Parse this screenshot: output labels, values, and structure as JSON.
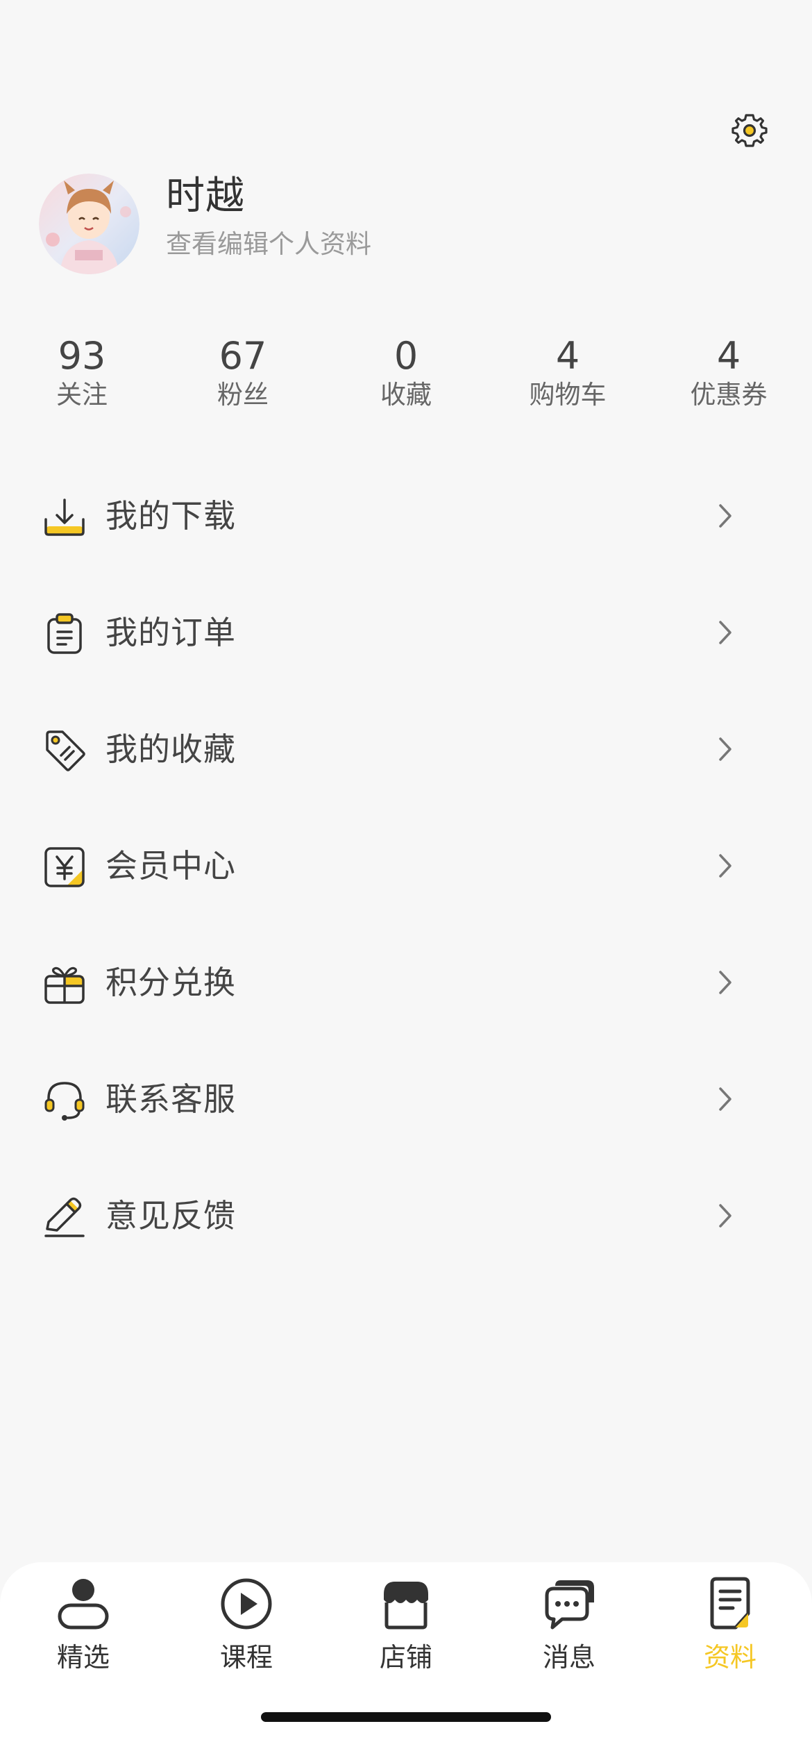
{
  "profile": {
    "name": "时越",
    "edit_link": "查看编辑个人资料"
  },
  "stats": [
    {
      "value": "93",
      "label": "关注"
    },
    {
      "value": "67",
      "label": "粉丝"
    },
    {
      "value": "0",
      "label": "收藏"
    },
    {
      "value": "4",
      "label": "购物车"
    },
    {
      "value": "4",
      "label": "优惠券"
    }
  ],
  "menu": [
    {
      "label": "我的下载",
      "icon": "download-icon"
    },
    {
      "label": "我的订单",
      "icon": "order-icon"
    },
    {
      "label": "我的收藏",
      "icon": "tag-icon"
    },
    {
      "label": "会员中心",
      "icon": "yuan-icon"
    },
    {
      "label": "积分兑换",
      "icon": "gift-icon"
    },
    {
      "label": "联系客服",
      "icon": "headset-icon"
    },
    {
      "label": "意见反馈",
      "icon": "pencil-icon"
    }
  ],
  "tabs": [
    {
      "label": "精选",
      "icon": "person-icon"
    },
    {
      "label": "课程",
      "icon": "play-icon"
    },
    {
      "label": "店铺",
      "icon": "store-icon"
    },
    {
      "label": "消息",
      "icon": "chat-icon"
    },
    {
      "label": "资料",
      "icon": "document-icon",
      "active": true
    }
  ],
  "colors": {
    "accent": "#f5c724",
    "background": "#f7f7f7",
    "text": "#333333",
    "muted": "#9a9a9a"
  }
}
